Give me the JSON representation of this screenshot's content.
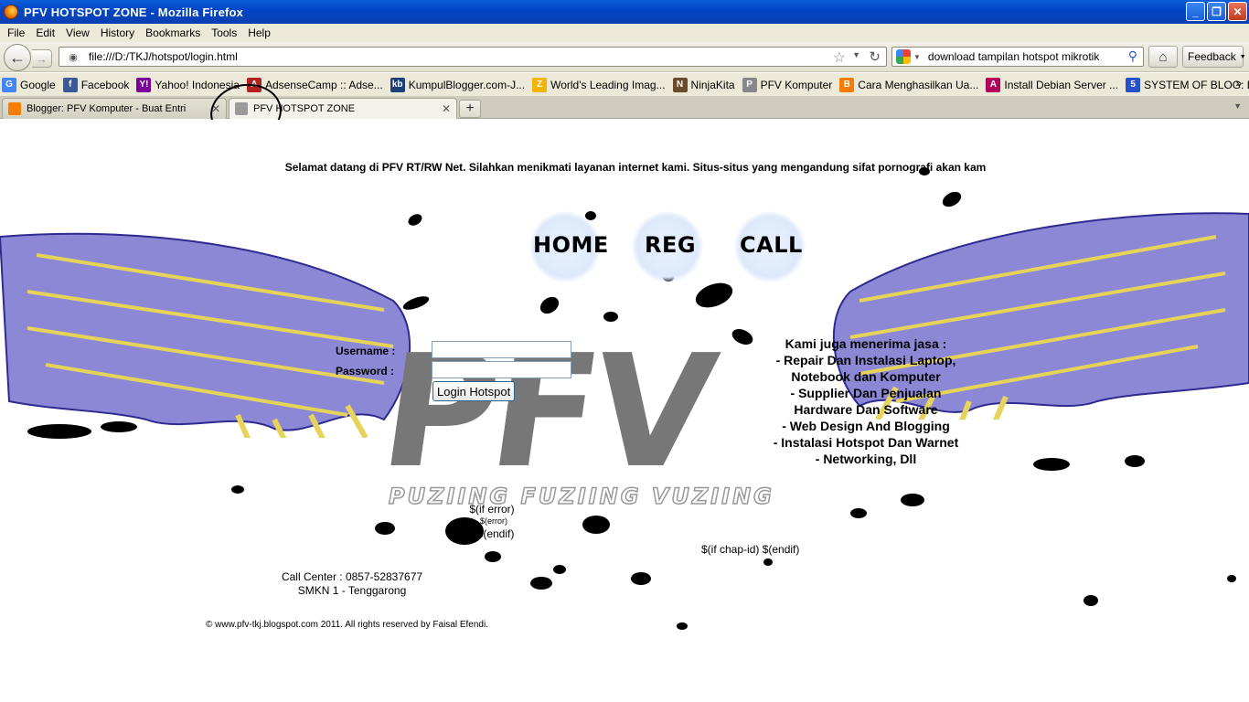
{
  "window": {
    "title": "PFV HOTSPOT ZONE - Mozilla Firefox",
    "minimize_glyph": "_",
    "maximize_glyph": "❐",
    "close_glyph": "✕"
  },
  "menu": [
    "File",
    "Edit",
    "View",
    "History",
    "Bookmarks",
    "Tools",
    "Help"
  ],
  "navbar": {
    "url": "file:///D:/TKJ/hotspot/login.html",
    "search_value": "download tampilan hotspot mikrotik",
    "feedback_label": "Feedback"
  },
  "bookmarks": [
    {
      "label": "Google",
      "icon": "google-icon",
      "color": "#4285f4"
    },
    {
      "label": "Facebook",
      "icon": "facebook-icon",
      "color": "#3b5998"
    },
    {
      "label": "Yahoo! Indonesia",
      "icon": "yahoo-icon",
      "color": "#7b0099"
    },
    {
      "label": "AdsenseCamp :: Adse...",
      "icon": "adsensecamp-icon",
      "color": "#b22222"
    },
    {
      "label": "KumpulBlogger.com-J...",
      "icon": "kumpulblogger-icon",
      "color": "#1c3f7a"
    },
    {
      "label": "World's Leading Imag...",
      "icon": "image-site-icon",
      "color": "#f2b400"
    },
    {
      "label": "NinjaKita",
      "icon": "ninjakita-icon",
      "color": "#6b4a2b"
    },
    {
      "label": "PFV Komputer",
      "icon": "pfv-icon",
      "color": "#888888"
    },
    {
      "label": "Cara Menghasilkan Ua...",
      "icon": "blogger-icon",
      "color": "#f57d00"
    },
    {
      "label": "Install Debian Server ...",
      "icon": "debian-icon",
      "color": "#b0005a"
    },
    {
      "label": "SYSTEM OF BLOG: Da...",
      "icon": "blog-icon",
      "color": "#2850c8"
    }
  ],
  "tabs": [
    {
      "label": "Blogger: PFV Komputer - Buat Entri",
      "icon": "blogger-icon"
    },
    {
      "label": "PFV HOTSPOT ZONE",
      "icon": "pfv-icon"
    }
  ],
  "page": {
    "welcome": "Selamat datang di PFV RT/RW Net. Silahkan menikmati layanan internet kami. Situs-situs yang mengandung sifat pornografi akan kam",
    "nav": [
      "HOME",
      "REG",
      "CALL"
    ],
    "logo_text": "PFV",
    "logo_subtitle": "PUZIING FUZIING VUZIING",
    "login": {
      "username_label": "Username :",
      "password_label": "Password :",
      "button_label": "Login Hotspot"
    },
    "services": [
      "Kami juga menerima jasa :",
      "- Repair Dan Instalasi Laptop,",
      "Notebook dan Komputer",
      "- Supplier Dan Penjualan",
      "Hardware Dan Software",
      "- Web Design And Blogging",
      "- Instalasi Hotspot Dan Warnet",
      "- Networking, Dll"
    ],
    "error_block": [
      "$(if error)",
      "$(error)",
      "$(endif)"
    ],
    "chap_block": "$(if chap-id) $(endif)",
    "call_center": "Call Center : 0857-52837677",
    "school": "SMKN 1 - Tenggarong",
    "copyright": "© www.pfv-tkj.blogspot.com 2011. All rights reserved by Faisal Efendi."
  }
}
